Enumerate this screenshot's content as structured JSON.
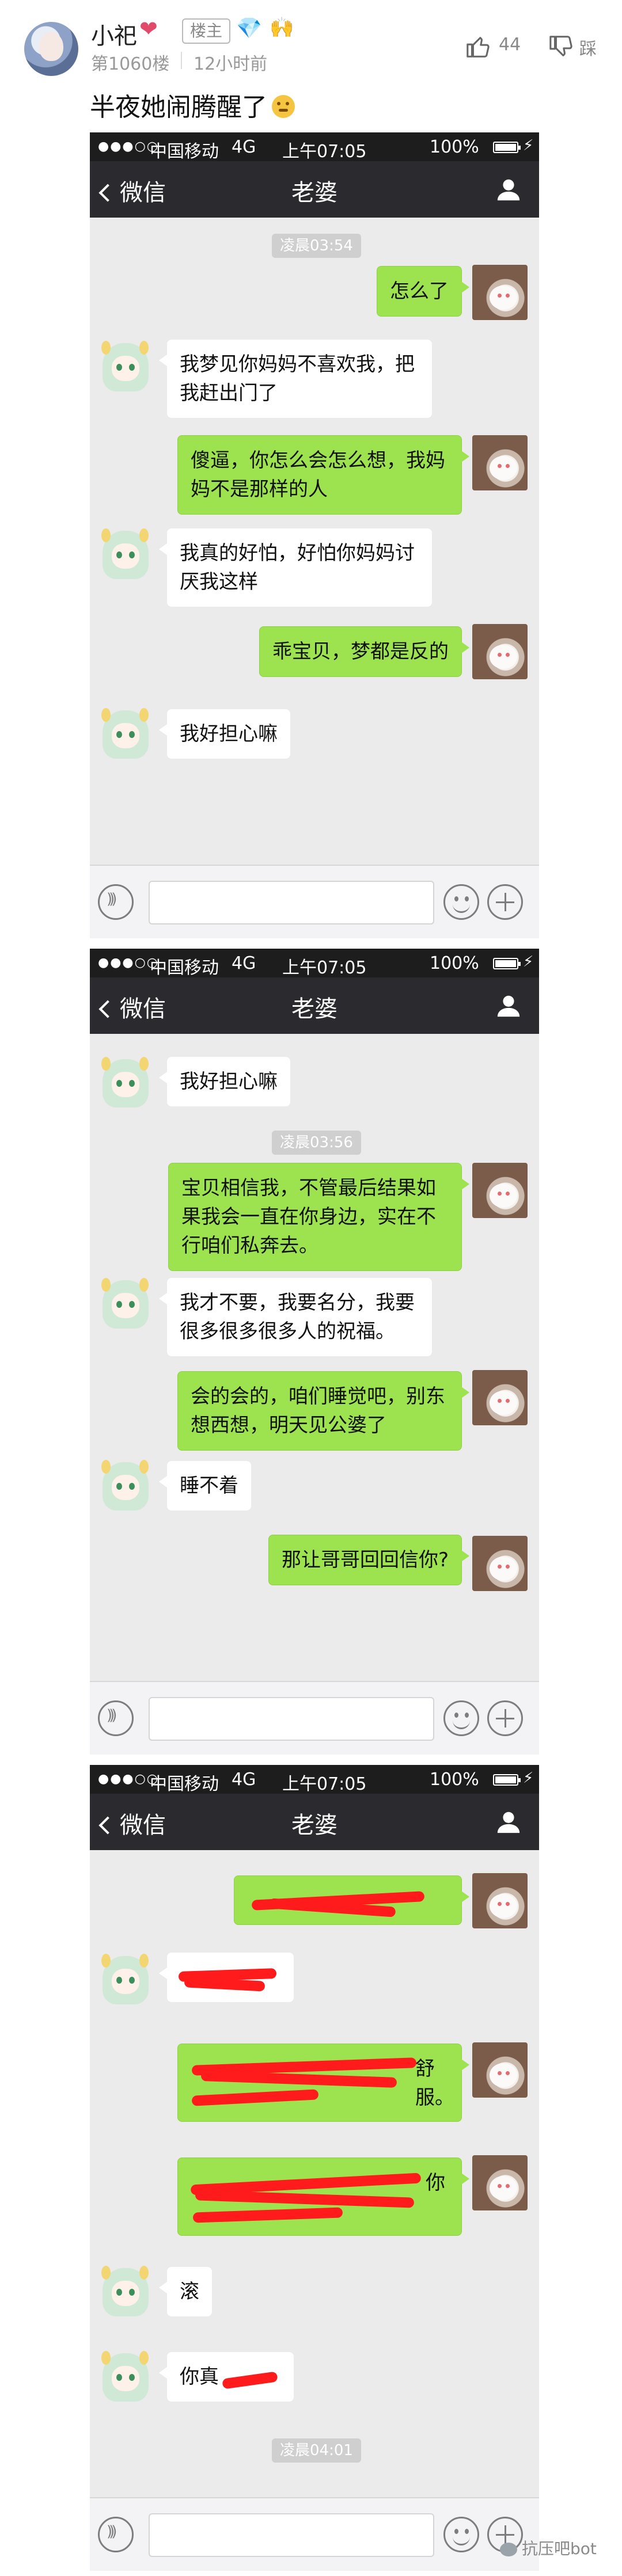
{
  "post": {
    "username": "小祀",
    "heart_icon": "heart-icon",
    "author_badge": "楼主",
    "floor": "第1060楼",
    "time": "12小时前",
    "likes": "44",
    "dislike_label": "踩",
    "title": "半夜她闹腾醒了"
  },
  "phone": {
    "status": {
      "signal": "●●●○○",
      "carrier": "中国移动",
      "network": "4G",
      "clock": "上午07:05",
      "battery": "100%"
    },
    "nav": {
      "back_label": "微信",
      "title": "老婆"
    }
  },
  "screens": [
    {
      "timestamp": "凌晨03:54",
      "messages": [
        {
          "side": "right",
          "text": "怎么了"
        },
        {
          "side": "left",
          "text": "我梦见你妈妈不喜欢我，把我赶出门了"
        },
        {
          "side": "right",
          "text": "傻逼，你怎么会怎么想，我妈妈不是那样的人"
        },
        {
          "side": "left",
          "text": "我真的好怕，好怕你妈妈讨厌我这样"
        },
        {
          "side": "right",
          "text": "乖宝贝，梦都是反的"
        },
        {
          "side": "left",
          "text": "我好担心嘛"
        }
      ]
    },
    {
      "timestamp": "凌晨03:56",
      "messages": [
        {
          "side": "left",
          "text": "我好担心嘛"
        },
        {
          "side": "right",
          "text": "宝贝相信我，不管最后结果如果我会一直在你身边，实在不行咱们私奔去。"
        },
        {
          "side": "left",
          "text": "我才不要，我要名分，我要很多很多很多人的祝福。"
        },
        {
          "side": "right",
          "text": "会的会的，咱们睡觉吧，别东想西想，明天见公婆了"
        },
        {
          "side": "left",
          "text": "睡不着"
        },
        {
          "side": "right",
          "text": "那让哥哥回回信你?"
        }
      ]
    },
    {
      "timestamp": "凌晨04:01",
      "messages": [
        {
          "side": "right",
          "text": ""
        },
        {
          "side": "left",
          "text": ""
        },
        {
          "side": "right",
          "text": "舒服。"
        },
        {
          "side": "right",
          "text": "你"
        },
        {
          "side": "left",
          "text": "滚"
        },
        {
          "side": "left",
          "text": "你真"
        }
      ]
    }
  ],
  "watermark": "抗压吧bot",
  "colors": {
    "chat_bg": "#ebebeb",
    "nav_bg": "#2b2b2f",
    "bubble_green": "#9de34f",
    "redaction_red": "#ff1b1b"
  }
}
